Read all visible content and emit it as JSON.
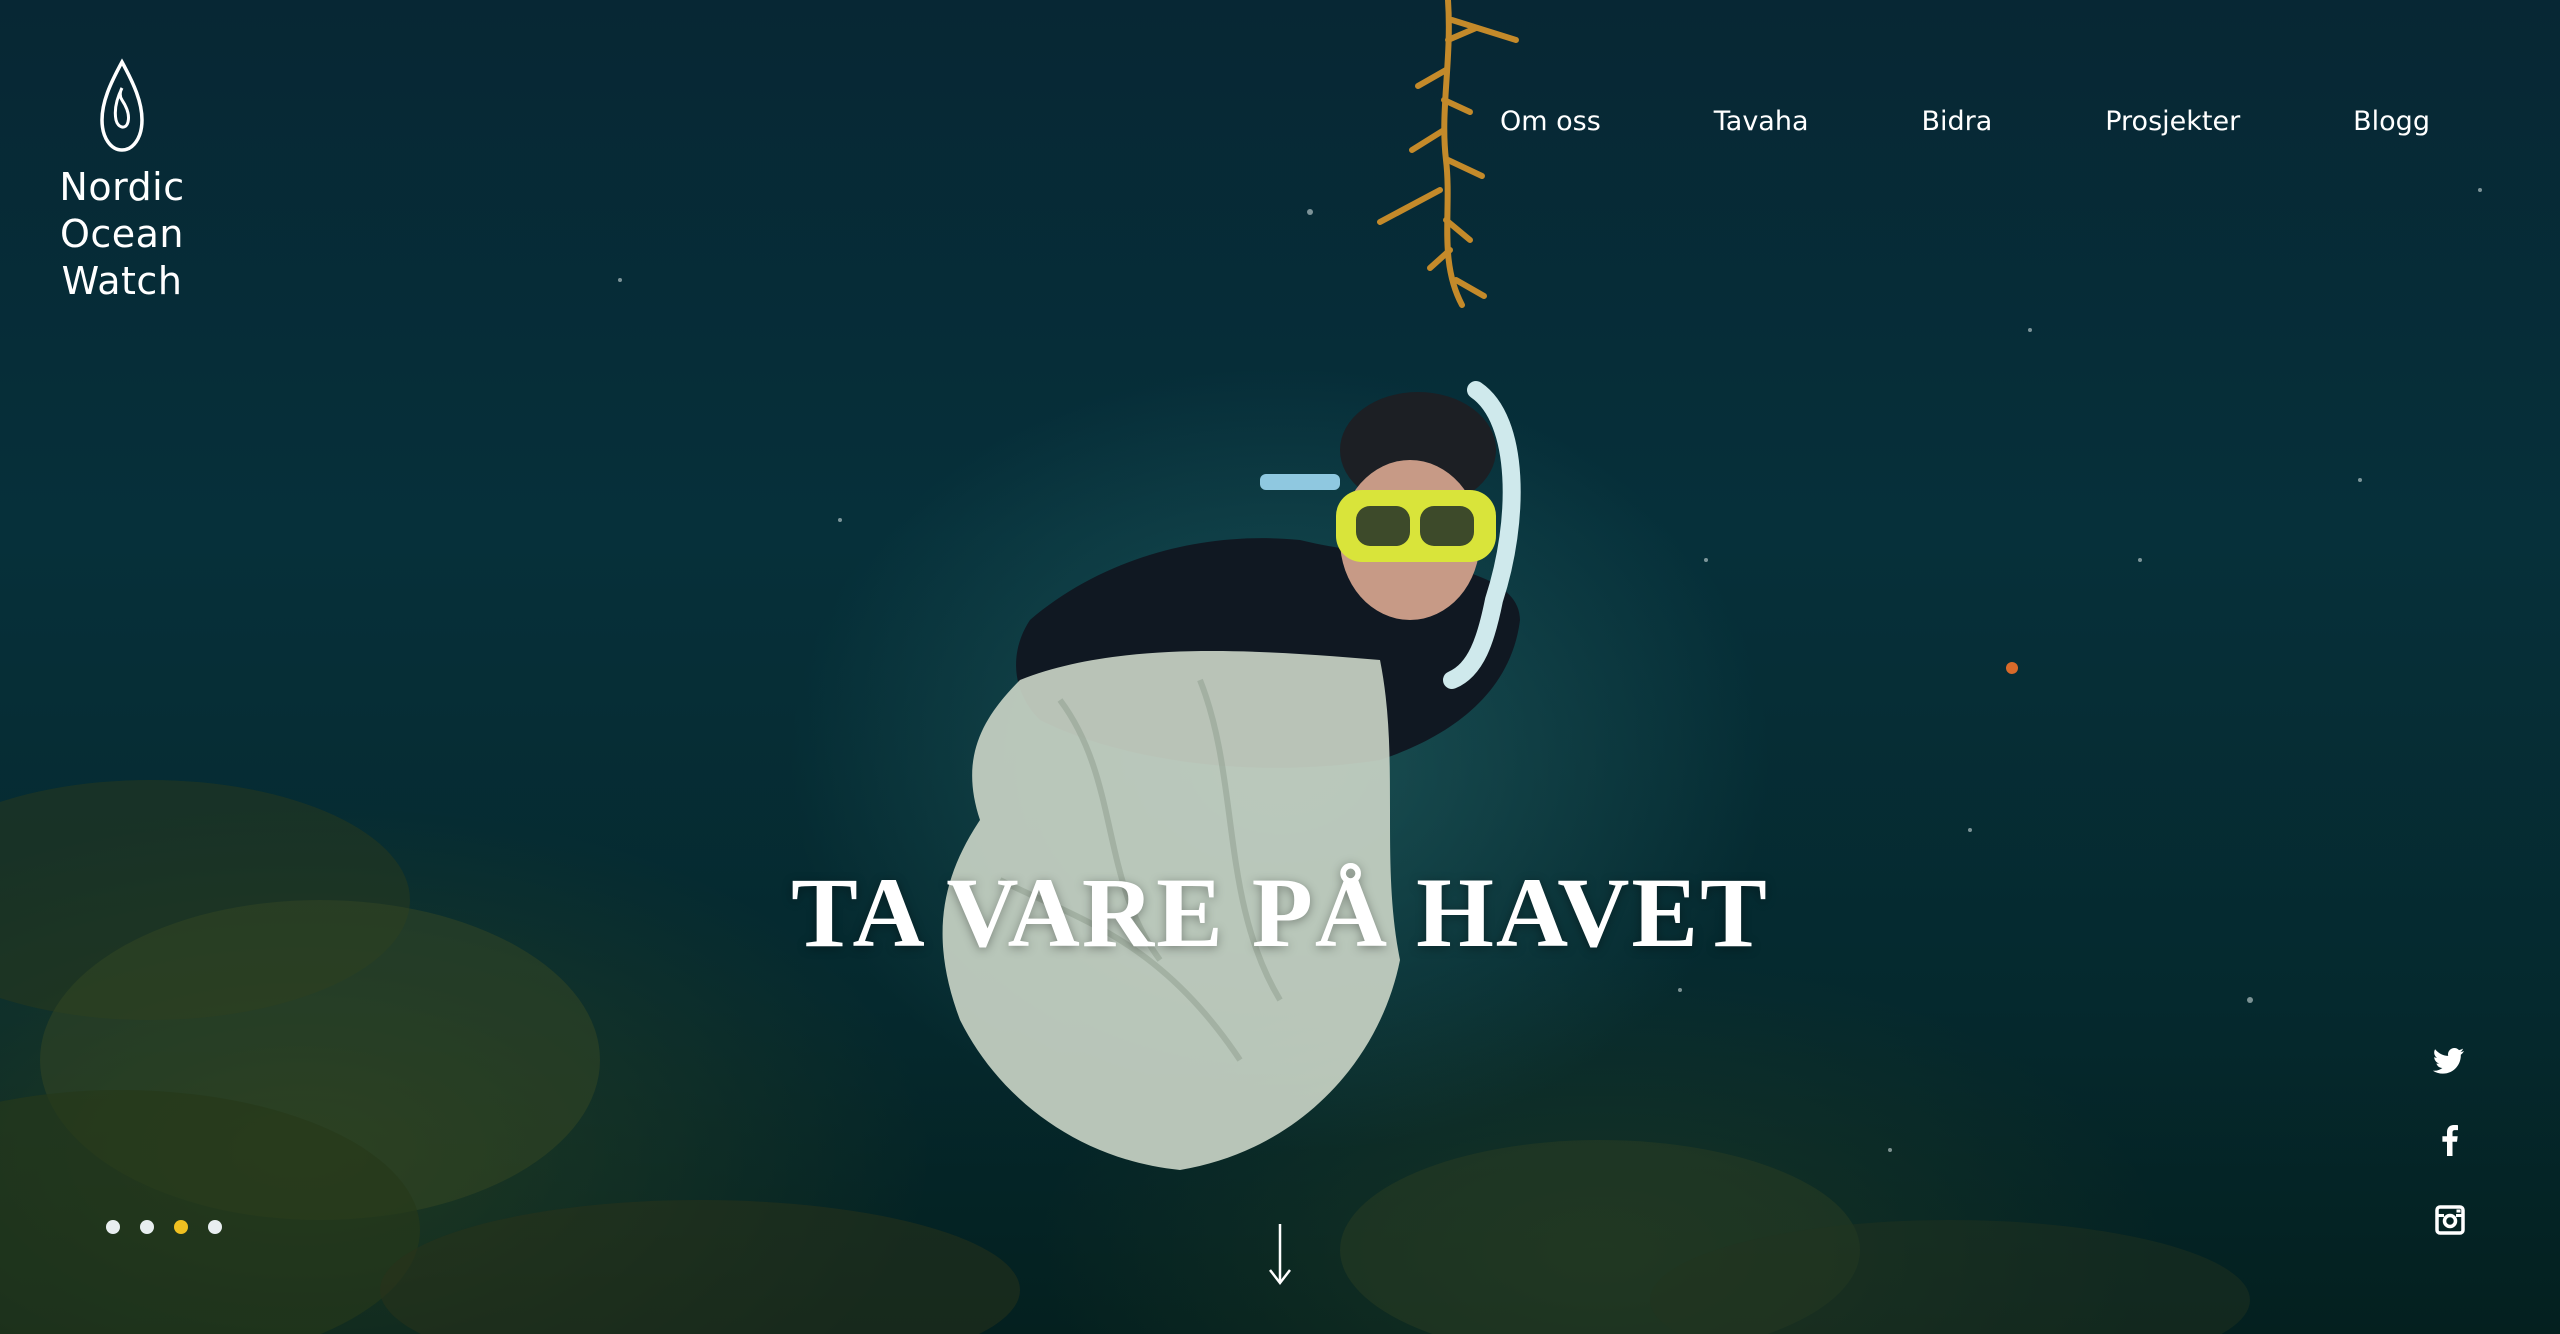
{
  "brand": {
    "logo_lines": [
      "Nordic",
      "Ocean",
      "Watch"
    ],
    "logo_icon": "water-drop-icon"
  },
  "nav": {
    "items": [
      {
        "label": "Om oss"
      },
      {
        "label": "Tavaha"
      },
      {
        "label": "Bidra"
      },
      {
        "label": "Prosjekter"
      },
      {
        "label": "Blogg"
      }
    ]
  },
  "hero": {
    "headline": "TA VARE PÅ HAVET",
    "background_image": "underwater-diver-with-trash-bag"
  },
  "slider": {
    "count": 4,
    "active_index": 2
  },
  "social": {
    "icons": [
      "twitter-icon",
      "facebook-icon",
      "instagram-icon"
    ]
  },
  "scroll": {
    "icon": "arrow-down-icon"
  },
  "colors": {
    "accent": "#f0c021",
    "text": "#ffffff",
    "ocean_dark": "#05222a"
  }
}
